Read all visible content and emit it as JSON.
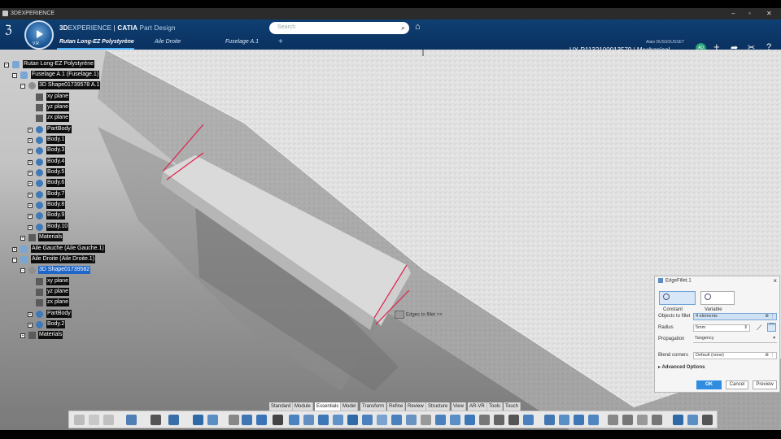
{
  "window": {
    "title": "3DEXPERIENCE"
  },
  "header": {
    "brand_3d": "3D",
    "brand_experience": "EXPERIENCE",
    "brand_sep": " | ",
    "brand_catia": "CATIA",
    "brand_app": " Part Design",
    "compass_version": "V.R",
    "tabs": [
      "Rutan Long-EZ Polystyrène",
      "Aile Droite",
      "Fuselage A.1"
    ],
    "add_tab": "+",
    "search_placeholder": "Search",
    "user_name": "Alain DUSSOUSSET",
    "project": "UX R1132100013579 | Mechanical ...",
    "avatar_initials": "AD"
  },
  "tree": {
    "items": [
      {
        "label": "Rutan Long-EZ Polystyrène",
        "style": "dark"
      },
      {
        "label": "Fuselage A.1 (Fuselage.1)",
        "style": "dark"
      },
      {
        "label": "3D Shape01739578 A.1",
        "style": "dark"
      },
      {
        "label": "xy plane",
        "style": "dark"
      },
      {
        "label": "yz plane",
        "style": "dark"
      },
      {
        "label": "zx plane",
        "style": "dark"
      },
      {
        "label": "PartBody",
        "style": "dark"
      },
      {
        "label": "Body.1",
        "style": "dark"
      },
      {
        "label": "Body.3",
        "style": "dark"
      },
      {
        "label": "Body.4",
        "style": "dark"
      },
      {
        "label": "Body.5",
        "style": "dark"
      },
      {
        "label": "Body.6",
        "style": "dark"
      },
      {
        "label": "Body.7",
        "style": "dark"
      },
      {
        "label": "Body.8",
        "style": "dark"
      },
      {
        "label": "Body.9",
        "style": "dark"
      },
      {
        "label": "Body.10",
        "style": "dark"
      },
      {
        "label": "Materials",
        "style": "dark"
      },
      {
        "label": "Aile Gauche (Aile Gauche.1)",
        "style": "dark"
      },
      {
        "label": "Aile Droite (Aile Droite.1)",
        "style": "dark"
      },
      {
        "label": "3D Shape01739582",
        "style": "selected"
      },
      {
        "label": "xy plane",
        "style": "dark"
      },
      {
        "label": "yz plane",
        "style": "dark"
      },
      {
        "label": "zx plane",
        "style": "dark"
      },
      {
        "label": "PartBody",
        "style": "dark"
      },
      {
        "label": "Body.2",
        "style": "dark"
      },
      {
        "label": "Materials",
        "style": "dark"
      }
    ]
  },
  "viewport": {
    "edges_hint": "Edges to fillet >>"
  },
  "panel": {
    "title": "EdgeFillet.1",
    "mode_constant": "Constant",
    "mode_variable": "Variable",
    "objects_label": "Objects to fillet",
    "objects_value": "4 elements",
    "radius_label": "Radius",
    "radius_value": "5mm",
    "propagation_label": "Propagation",
    "propagation_value": "Tangency",
    "blend_label": "Blend corners",
    "blend_value": "Default (none)",
    "advanced": "Advanced Options",
    "ok": "OK",
    "cancel": "Cancel",
    "preview": "Preview"
  },
  "section_tabs": [
    "Standard",
    "Module",
    "Essentials",
    "Model",
    "Transform",
    "Refine",
    "Review",
    "Structure",
    "View",
    "AR-VR",
    "Tools",
    "Touch"
  ],
  "active_section_tab": "Essentials"
}
